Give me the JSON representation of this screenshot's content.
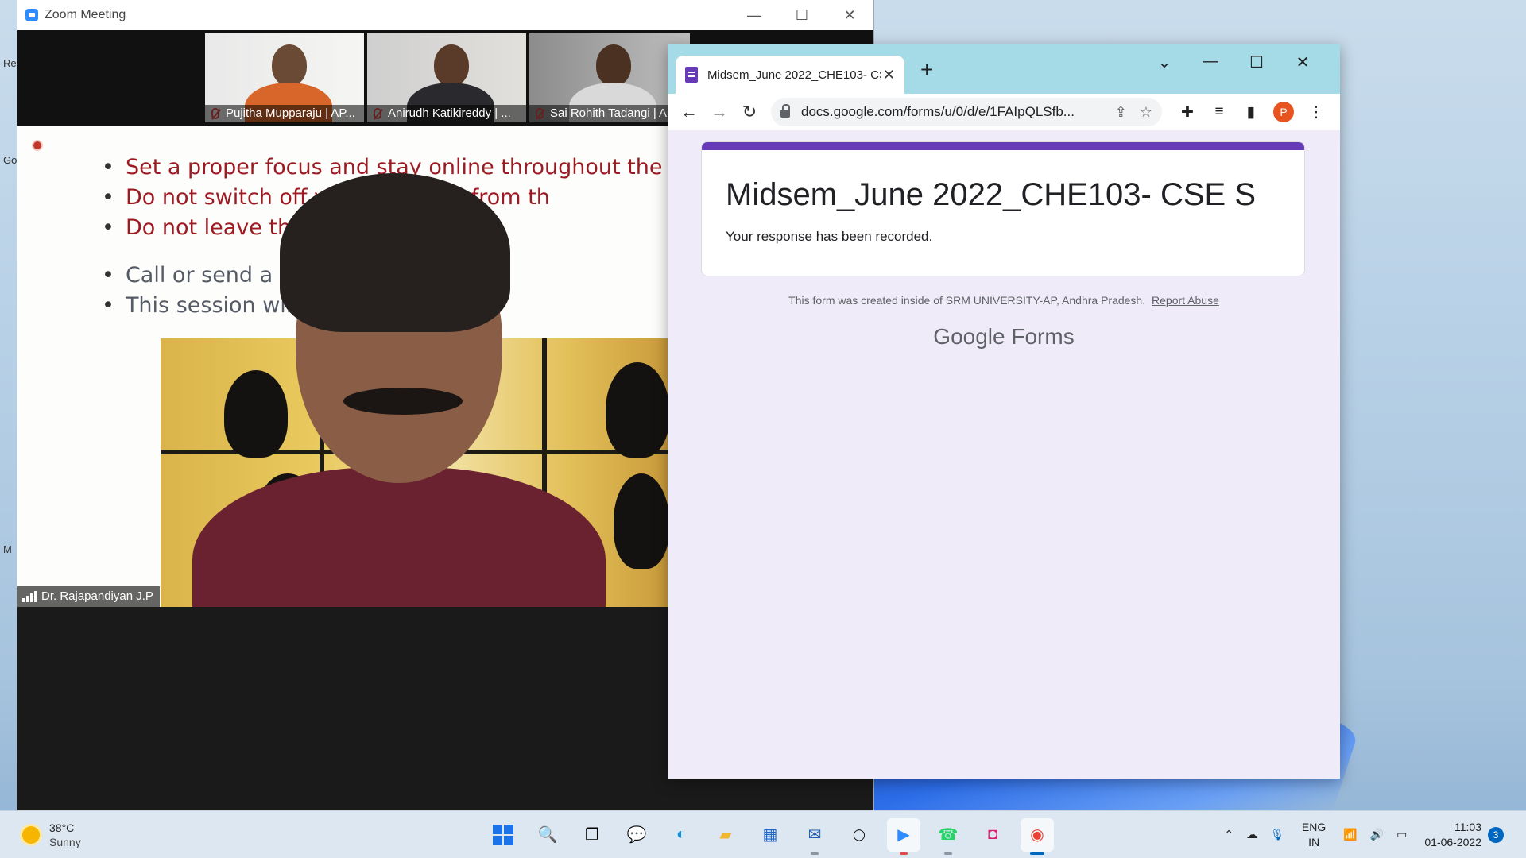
{
  "zoom": {
    "title": "Zoom Meeting",
    "controls": [
      "—",
      "☐",
      "✕"
    ],
    "participants": [
      {
        "name": "Pujitha Mupparaju | AP..."
      },
      {
        "name": "Anirudh Katikireddy | ..."
      },
      {
        "name": "Sai Rohith Tadangi | A"
      }
    ],
    "speaker_name": "Dr. Rajapandiyan J.P",
    "slide": {
      "bullets_red": [
        "Set a proper focus and stay online throughout the sess",
        "Do not switch off your c                 e away from th",
        "Do not leave this Zoom                       bmitting th"
      ],
      "bullets_gray": [
        "Call or send a messag                               s",
        "This session will be re                  aluation"
      ]
    }
  },
  "chrome": {
    "tab_title": "Midsem_June 2022_CHE103- CSE S",
    "tab_close": "✕",
    "new_tab": "+",
    "window_controls": [
      "⌄",
      "—",
      "☐",
      "✕"
    ],
    "nav": {
      "back": "←",
      "forward": "→",
      "reload": "↻"
    },
    "url": "docs.google.com/forms/u/0/d/e/1FAIpQLSfb...",
    "profile_initial": "P",
    "form": {
      "title": "Midsem_June 2022_CHE103- CSE S",
      "message": "Your response has been recorded.",
      "footer": "This form was created inside of SRM UNIVERSITY-AP, Andhra Pradesh.",
      "report_link": "Report Abuse",
      "brand_google": "Google",
      "brand_forms": "Forms"
    }
  },
  "taskbar": {
    "weather_temp": "38°C",
    "weather_cond": "Sunny",
    "language_top": "ENG",
    "language_bottom": "IN",
    "time": "11:03",
    "date": "01-06-2022",
    "notification_count": "3",
    "accent": "#0067c0"
  },
  "desktop": {
    "fragments": [
      "Re",
      "Go",
      "M"
    ]
  }
}
